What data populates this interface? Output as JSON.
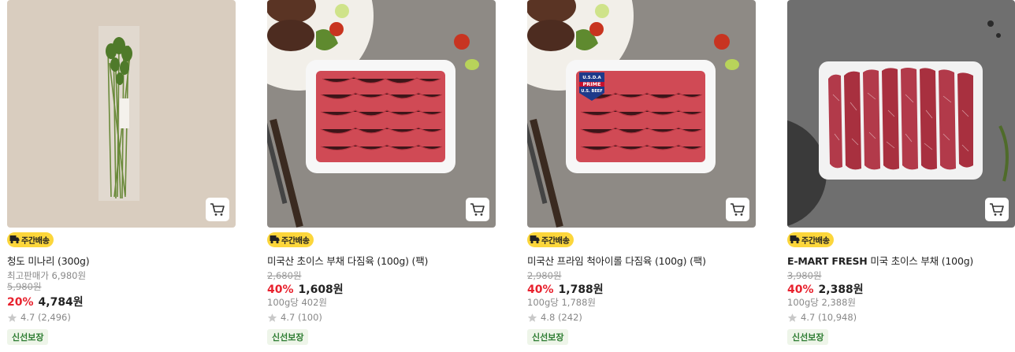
{
  "products": [
    {
      "delivery": "주간배송",
      "brand": "",
      "name": "청도 미나리 (300g)",
      "list_price_label": "최고판매가 6,980원",
      "original_price": "5,980원",
      "discount": "20%",
      "price": "4,784원",
      "unit_price": "",
      "rating": "4.7 (2,496)",
      "badge": "신선보장"
    },
    {
      "delivery": "주간배송",
      "brand": "",
      "name": "미국산 초이스 부채 다짐육 (100g) (팩)",
      "list_price_label": "",
      "original_price": "2,680원",
      "discount": "40%",
      "price": "1,608원",
      "unit_price": "100g당 402원",
      "rating": "4.7 (100)",
      "badge": "신선보장"
    },
    {
      "delivery": "주간배송",
      "brand": "",
      "name": "미국산 프라임 척아이롤 다짐육 (100g) (팩)",
      "list_price_label": "",
      "original_price": "2,980원",
      "discount": "40%",
      "price": "1,788원",
      "unit_price": "100g당 1,788원",
      "rating": "4.8 (242)",
      "badge": "신선보장",
      "label_top": "U.S.D.A",
      "label_mid": "PRIME",
      "label_bot": "U.S. BEEF"
    },
    {
      "delivery": "주간배송",
      "brand": "E-MART FRESH",
      "name": " 미국 초이스 부채 (100g)",
      "list_price_label": "",
      "original_price": "3,980원",
      "discount": "40%",
      "price": "2,388원",
      "unit_price": "100g당 2,388원",
      "rating": "4.7 (10,948)",
      "badge": "신선보장"
    }
  ],
  "icons": {
    "cart": "cart-icon",
    "truck": "delivery-truck-icon",
    "star": "star-icon"
  },
  "colors": {
    "discount": "#e8222e",
    "delivery_badge": "#fcd63b",
    "fresh_badge_text": "#2e7d32",
    "fresh_badge_bg": "#eef5e9"
  }
}
